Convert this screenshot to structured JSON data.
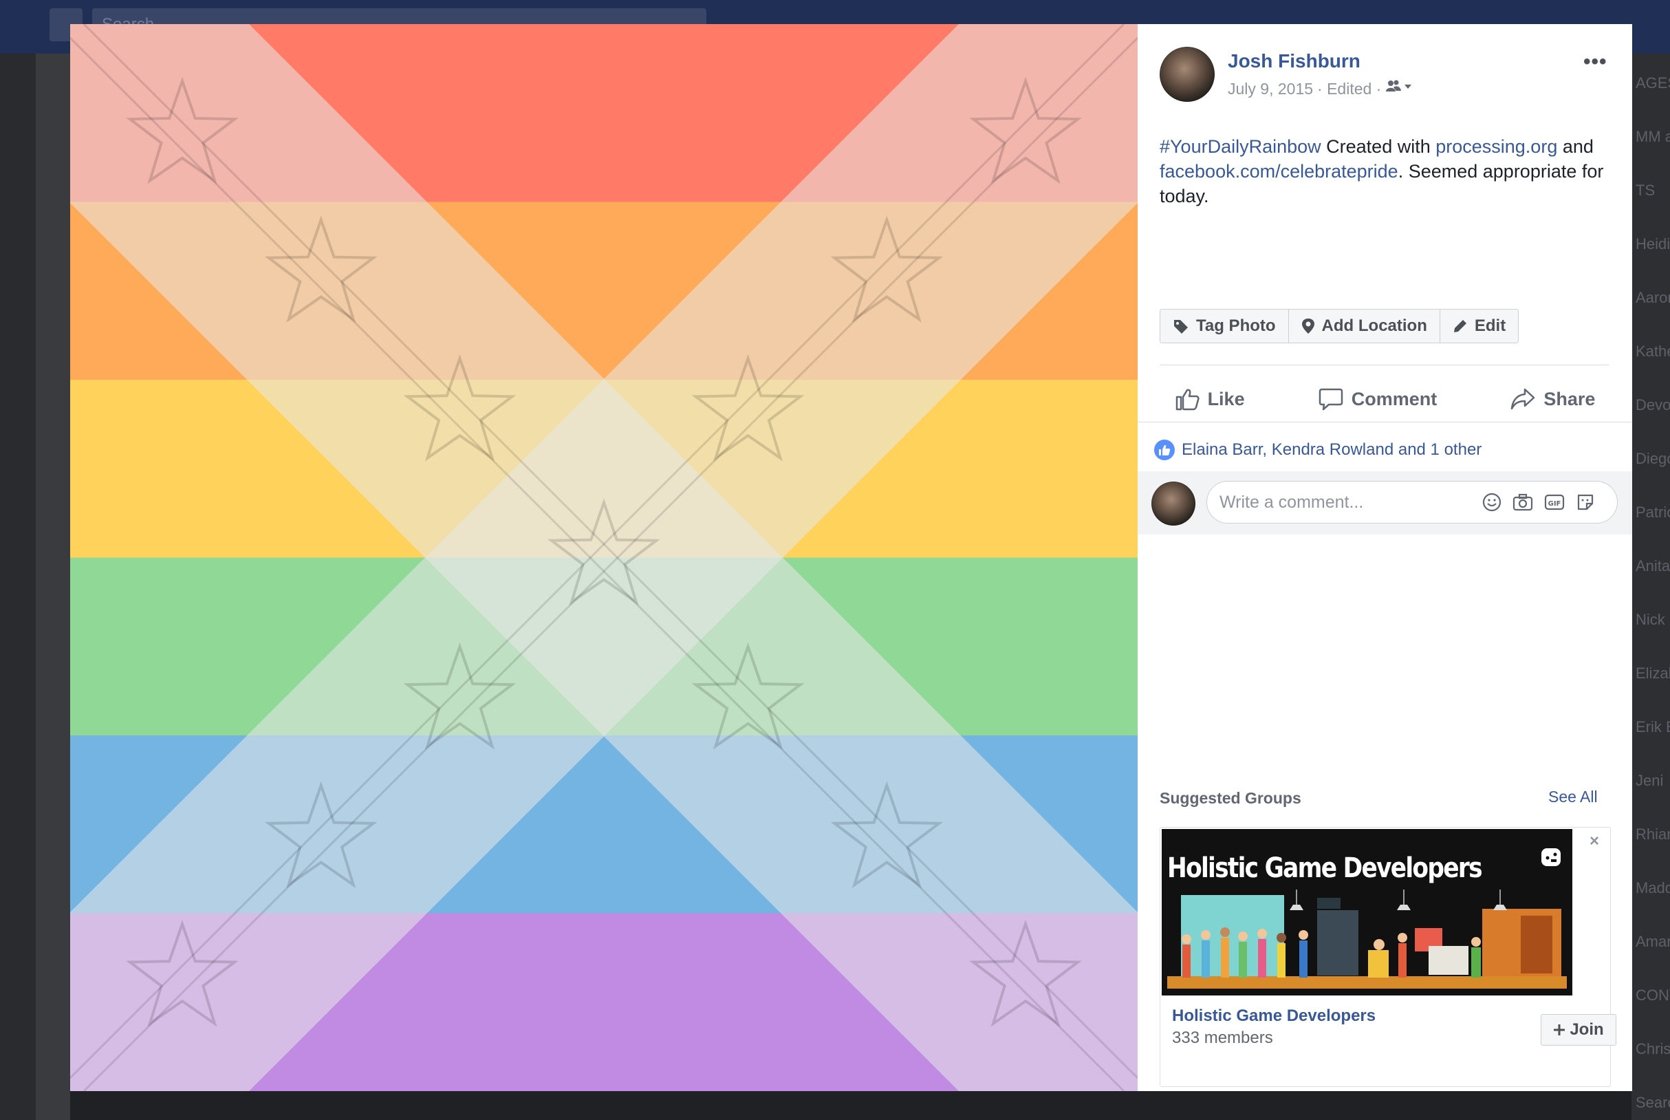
{
  "background": {
    "search_placeholder": "Search",
    "right_sidebar_fragments": [
      "AGES",
      "MM a",
      "TS",
      "Heidi",
      "Aaron",
      "Kathe",
      "Devo",
      "Diego",
      "Patric",
      "Anita",
      "Nick",
      "Elizab",
      "Erik E",
      "Jeni",
      "Rhian",
      "Madd",
      "Amar",
      "CONV",
      "Chris",
      "Search"
    ]
  },
  "photo": {
    "stripe_colors": [
      "#ff7b67",
      "#ffaa58",
      "#ffd25c",
      "#8fd896",
      "#74b4e2",
      "#c28be3"
    ],
    "stripe_tint": "#e7e7e7"
  },
  "post": {
    "author": "Josh Fishburn",
    "date": "July 9, 2015",
    "edited": "· Edited ·",
    "more_label": "•••",
    "text_parts": {
      "hashtag": "#YourDailyRainbow",
      "t1": " Created with ",
      "link1": "processing.org",
      "t2": " and ",
      "link2": "facebook.com/celebratepride",
      "t3": ". Seemed appropriate for today."
    },
    "photo_actions": {
      "tag_photo": "Tag Photo",
      "add_location": "Add Location",
      "edit": "Edit"
    },
    "reactions": {
      "like": "Like",
      "comment": "Comment",
      "share": "Share"
    },
    "likes_text": "Elaina Barr, Kendra Rowland and 1 other",
    "comment_placeholder": "Write a comment..."
  },
  "suggested_groups": {
    "title": "Suggested Groups",
    "see_all": "See All",
    "group": {
      "banner_title": "Holistic Game Developers",
      "name": "Holistic Game Developers",
      "members": "333 members",
      "join_label": "Join",
      "close_label": "×"
    }
  },
  "colors": {
    "link": "#385898",
    "like_blue": "#5890ff",
    "text": "#1d2129",
    "muted": "#90949c"
  }
}
